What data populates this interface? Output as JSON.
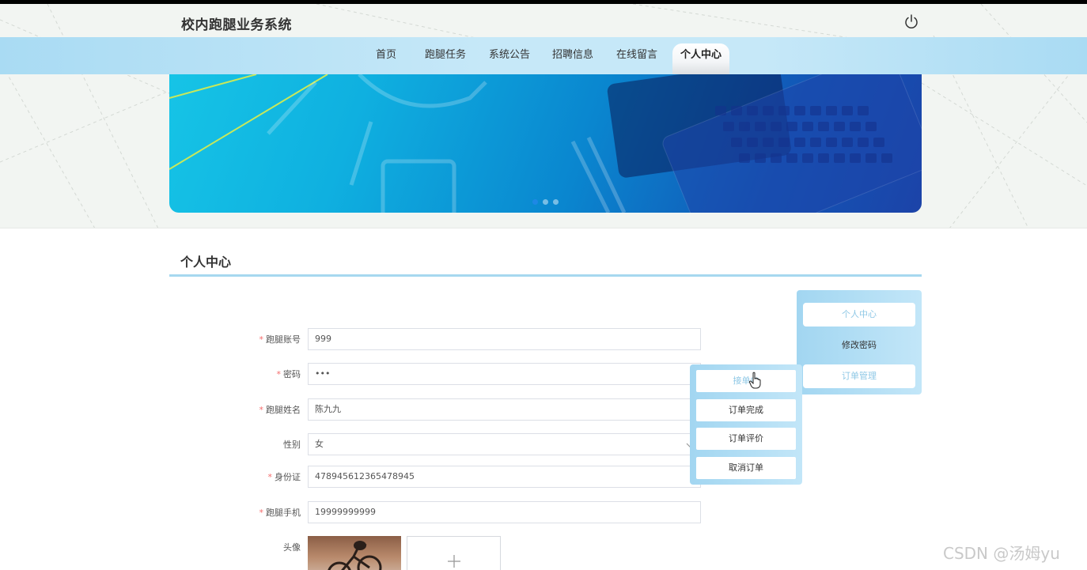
{
  "header": {
    "site_title": "校内跑腿业务系统",
    "power_icon": "power-icon"
  },
  "nav": {
    "items": [
      {
        "label": "首页",
        "active": false
      },
      {
        "label": "跑腿任务",
        "active": false
      },
      {
        "label": "系统公告",
        "active": false
      },
      {
        "label": "招聘信息",
        "active": false
      },
      {
        "label": "在线留言",
        "active": false
      },
      {
        "label": "个人中心",
        "active": true
      }
    ]
  },
  "banner": {
    "slide_count": 3,
    "active_slide": 1
  },
  "section": {
    "title": "个人中心"
  },
  "form": {
    "account_label": "跑腿账号",
    "account_value": "999",
    "password_label": "密码",
    "password_value": "•••",
    "name_label": "跑腿姓名",
    "name_value": "陈九九",
    "gender_label": "性别",
    "gender_value": "女",
    "id_label": "身份证",
    "id_value": "478945612365478945",
    "phone_label": "跑腿手机",
    "phone_value": "19999999999",
    "avatar_label": "头像",
    "required_mark": "*"
  },
  "side_menu": {
    "items": [
      {
        "label": "个人中心"
      },
      {
        "label": "修改密码"
      },
      {
        "label": "订单管理"
      }
    ]
  },
  "order_submenu": {
    "items": [
      {
        "label": "接单中"
      },
      {
        "label": "订单完成"
      },
      {
        "label": "订单评价"
      },
      {
        "label": "取消订单"
      }
    ]
  },
  "watermark": "CSDN @汤姆yu",
  "colors": {
    "nav_bg": "#c6e8f8",
    "accent_line": "#a6d8ef",
    "required": "#f56c6c",
    "menu_highlight_text": "#8fc8e6",
    "dot_active": "#1e88e5"
  }
}
